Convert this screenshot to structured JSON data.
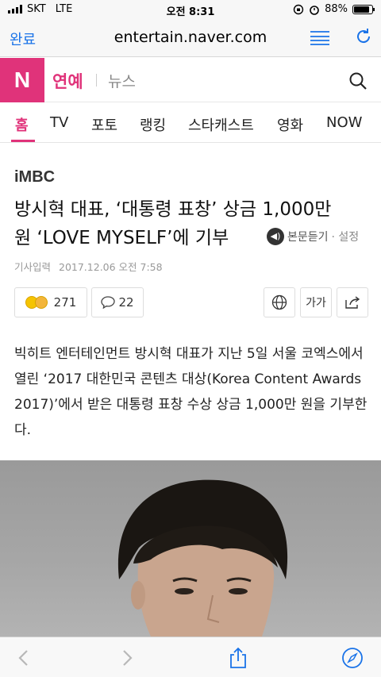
{
  "status_bar": {
    "carrier": "SKT",
    "network": "LTE",
    "time": "오전 8:31",
    "battery_text": "88%",
    "battery_level": 0.88
  },
  "browser": {
    "done_label": "완료",
    "url": "entertain.naver.com",
    "icons": [
      "reader-menu-icon",
      "reload-icon"
    ]
  },
  "naver_header": {
    "logo_letter": "N",
    "section": "연예",
    "subsection": "뉴스",
    "accent_color": "#e0337a"
  },
  "tabs": [
    {
      "label": "홈",
      "active": true
    },
    {
      "label": "TV",
      "active": false
    },
    {
      "label": "포토",
      "active": false
    },
    {
      "label": "랭킹",
      "active": false
    },
    {
      "label": "스타캐스트",
      "active": false
    },
    {
      "label": "영화",
      "active": false
    },
    {
      "label": "NOW",
      "active": false
    }
  ],
  "article": {
    "source_logo": "iMBC",
    "title_line1": "방시혁 대표, ‘대통령 표창’ 상금 1,000만",
    "title_line2": "원 ‘LOVE MYSELF’에 기부",
    "tts_label": "본문듣기",
    "settings_label": "· 설정",
    "date_label": "기사입력",
    "date_value": "2017.12.06 오전 7:58",
    "reaction_count": "271",
    "comment_count": "22",
    "font_size_label": "가가",
    "body": "빅히트 엔터테인먼트 방시혁 대표가 지난 5일 서울 코엑스에서 열린 ‘2017 대한민국 콘텐츠 대상(Korea Content Awards 2017)’에서 받은 대통령 표창 수상 상금 1,000만 원을 기부한다."
  },
  "toolbar": {
    "icons": [
      "back-icon",
      "forward-icon",
      "share-icon",
      "compass-icon"
    ]
  }
}
